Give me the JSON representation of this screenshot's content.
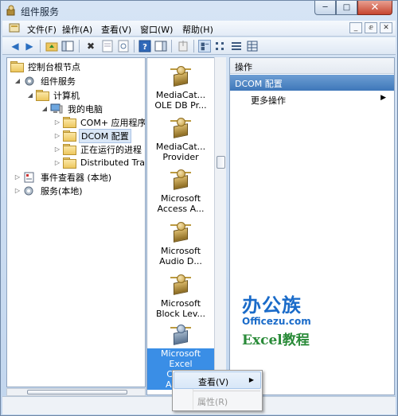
{
  "window": {
    "title": "组件服务",
    "caption": {
      "minimize": "─",
      "maximize": "□",
      "close": "✕"
    }
  },
  "menubar": {
    "items": [
      "文件(F)",
      "操作(A)",
      "查看(V)",
      "窗口(W)",
      "帮助(H)"
    ],
    "mdi": [
      "_",
      "ⅇ",
      "✕"
    ]
  },
  "toolbar": {
    "buttons": [
      "back-icon",
      "forward-icon",
      "up-folder-icon",
      "show-hide-tree-icon",
      "delete-icon",
      "properties-icon",
      "refresh-icon",
      "help-icon",
      "show-hide-action-icon",
      "install-icon",
      "large-icons-view",
      "small-icons-view",
      "list-view",
      "detail-view"
    ]
  },
  "tree": {
    "nodes": [
      {
        "label": "控制台根节点",
        "icon": "folder-icon"
      },
      {
        "label": "组件服务",
        "icon": "component-services-icon",
        "toggle": "◢"
      },
      {
        "label": "计算机",
        "icon": "folder-icon",
        "toggle": "◢"
      },
      {
        "label": "我的电脑",
        "icon": "computer-icon",
        "toggle": "◢"
      },
      {
        "label": "COM+ 应用程序",
        "icon": "folder-icon",
        "toggle": "▷"
      },
      {
        "label": "DCOM 配置",
        "icon": "folder-icon",
        "toggle": "▷",
        "selected": true
      },
      {
        "label": "正在运行的进程",
        "icon": "folder-icon",
        "toggle": "▷"
      },
      {
        "label": "Distributed Trar",
        "icon": "folder-icon",
        "toggle": "▷"
      },
      {
        "label": "事件查看器 (本地)",
        "icon": "event-viewer-icon",
        "toggle": "▷"
      },
      {
        "label": "服务(本地)",
        "icon": "services-icon",
        "toggle": "▷"
      }
    ]
  },
  "components": {
    "items": [
      {
        "line1": "MediaCat...",
        "line2": "OLE DB Pr..."
      },
      {
        "line1": "MediaCat...",
        "line2": "Provider"
      },
      {
        "line1": "Microsoft",
        "line2": "Access A..."
      },
      {
        "line1": "Microsoft",
        "line2": "Audio D..."
      },
      {
        "line1": "Microsoft",
        "line2": "Block Lev..."
      },
      {
        "line1": "Microsoft",
        "line2": "Excel",
        "line3": "Char...",
        "line4": "Appli...",
        "selected": true
      }
    ]
  },
  "actions": {
    "header": "操作",
    "section": "DCOM 配置",
    "more": "更多操作",
    "more_arrow": "▶"
  },
  "watermark": {
    "cn": "办公族",
    "url": "Officezu.com",
    "excel": "Excel教程"
  },
  "context_menu": {
    "items": [
      {
        "label": "查看(V)",
        "arrow": "▶",
        "active": true
      },
      {
        "label": "属性(R)",
        "disabled": true
      }
    ]
  }
}
